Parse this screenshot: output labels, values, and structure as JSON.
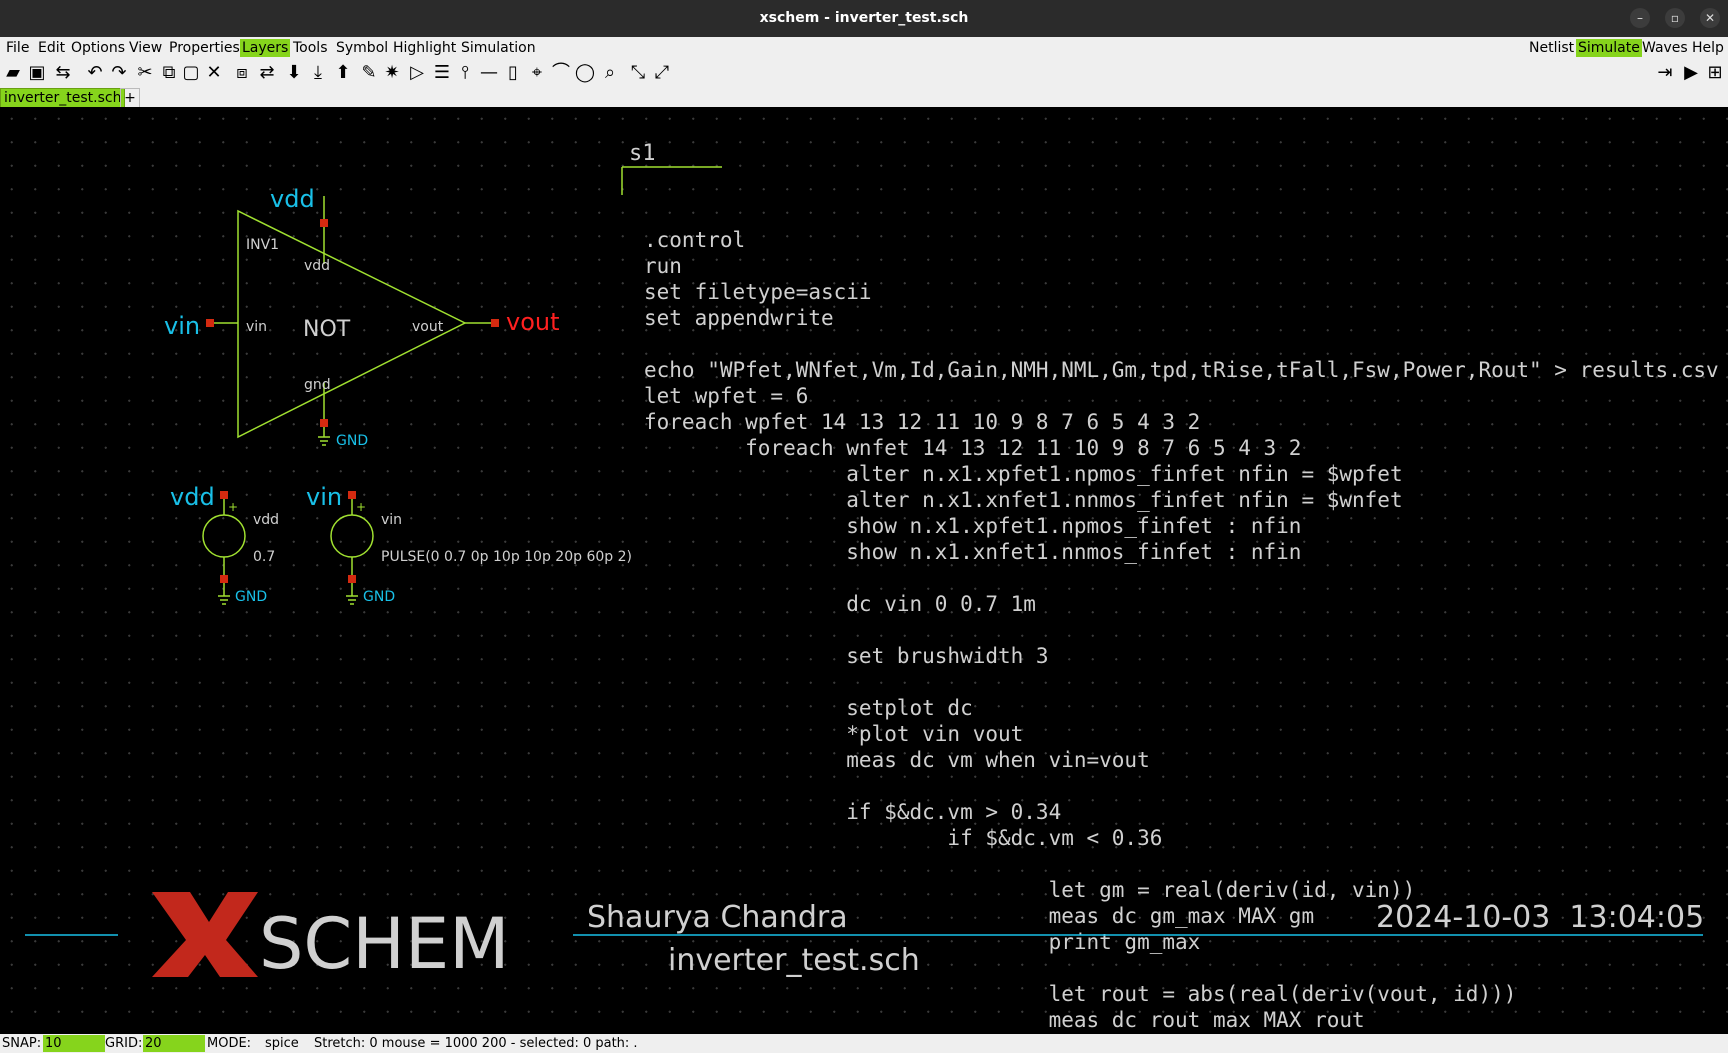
{
  "window": {
    "title": "xschem - inverter_test.sch"
  },
  "menubar": {
    "left": [
      "File",
      "Edit",
      "Options",
      "View",
      "Properties",
      "Layers",
      "Tools",
      "Symbol",
      "Highlight",
      "Simulation"
    ],
    "right": [
      "Netlist",
      "Simulate",
      "Waves",
      "Help"
    ],
    "active_left": "Layers",
    "active_right": "Simulate"
  },
  "toolbar": {
    "icons": [
      "open-icon",
      "save-icon",
      "reload-icon",
      "undo-icon",
      "redo-icon",
      "cut-icon",
      "copy-icon",
      "paste-icon",
      "delete-icon",
      "move-icon",
      "stretch-icon",
      "push-icon",
      "push-down-icon",
      "pop-icon",
      "edit-icon",
      "highlight-icon",
      "symbol-icon",
      "list-icon",
      "pin-icon",
      "line-icon",
      "rect-icon",
      "poly-icon",
      "arc-icon",
      "circle-icon",
      "zoom-icon",
      "zoom-full-icon",
      "zoom-fit-icon"
    ],
    "right_icons": [
      "insert-icon",
      "run-icon",
      "waves-icon"
    ]
  },
  "tabs": {
    "active": "inverter_test.sch",
    "add_label": "+"
  },
  "schematic": {
    "inverter": {
      "instance": "INV1",
      "function": "NOT",
      "pin_vdd": "vdd",
      "pin_vin": "vin",
      "pin_vout": "vout",
      "pin_gnd": "gnd",
      "net_vdd": "vdd",
      "net_vin": "vin",
      "net_vout": "vout",
      "net_gnd": "GND"
    },
    "source_vdd": {
      "net": "vdd",
      "name": "vdd",
      "value": "0.7",
      "gnd": "GND"
    },
    "source_vin": {
      "net": "vin",
      "name": "vin",
      "value": "PULSE(0 0.7 0p 10p 10p 20p 60p 2)",
      "gnd": "GND"
    },
    "code_block_name": "s1",
    "code_lines": [
      ".control",
      "run",
      "set filetype=ascii",
      "set appendwrite",
      "",
      "echo \"WPfet,WNfet,Vm,Id,Gain,NMH,NML,Gm,tpd,tRise,tFall,Fsw,Power,Rout\" > results.csv",
      "let wpfet = 6",
      "foreach wpfet 14 13 12 11 10 9 8 7 6 5 4 3 2",
      "        foreach wnfet 14 13 12 11 10 9 8 7 6 5 4 3 2",
      "                alter n.x1.xpfet1.npmos_finfet nfin = $wpfet",
      "                alter n.x1.xnfet1.nnmos_finfet nfin = $wnfet",
      "                show n.x1.xpfet1.npmos_finfet : nfin",
      "                show n.x1.xnfet1.nnmos_finfet : nfin",
      "",
      "                dc vin 0 0.7 1m",
      "",
      "                set brushwidth 3",
      "",
      "                setplot dc",
      "                *plot vin vout",
      "                meas dc vm when vin=vout",
      "",
      "                if $&dc.vm > 0.34",
      "                        if $&dc.vm < 0.36",
      "",
      "                                let gm = real(deriv(id, vin))",
      "                                meas dc gm_max MAX gm",
      "                                print gm_max",
      "",
      "                                let rout = abs(real(deriv(vout, id)))",
      "                                meas dc rout max MAX rout"
    ],
    "title_block": {
      "logo_letter": "X",
      "logo_rest": "SCHEM",
      "author": "Shaurya Chandra",
      "filename": "inverter_test.sch",
      "datetime": "2024-10-03  13:04:05"
    }
  },
  "status": {
    "snap_label": "SNAP:",
    "snap_value": "10",
    "grid_label": "GRID:",
    "grid_value": "20",
    "mode_label": "MODE:",
    "mode_value": "spice",
    "info": "Stretch: 0  mouse = 1000 200 - selected: 0 path: ."
  },
  "colors": {
    "wire": "#a0e030",
    "net_label": "#19c0e8",
    "output_label": "#ff2020",
    "pin": "#d42a10",
    "text": "#d0d0d0",
    "accent": "#86d41c",
    "logo_red": "#c2281c"
  }
}
